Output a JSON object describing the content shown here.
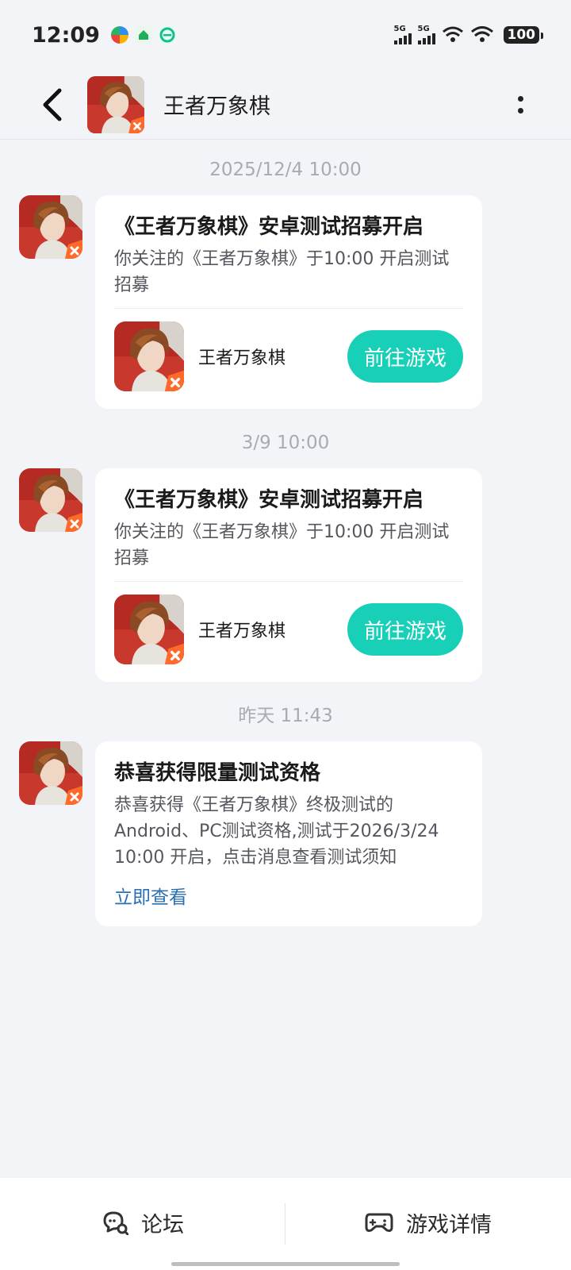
{
  "status_bar": {
    "time": "12:09",
    "signal1": "5G",
    "signal2": "5G",
    "battery": "100"
  },
  "header": {
    "title": "王者万象棋"
  },
  "messages": [
    {
      "time": "2025/12/4  10:00",
      "title": "《王者万象棋》安卓测试招募开启",
      "desc": "你关注的《王者万象棋》于10:00 开启测试招募",
      "game_name": "王者万象棋",
      "button": "前往游戏"
    },
    {
      "time": "3/9  10:00",
      "title": "《王者万象棋》安卓测试招募开启",
      "desc": "你关注的《王者万象棋》于10:00 开启测试招募",
      "game_name": "王者万象棋",
      "button": "前往游戏"
    },
    {
      "time": "昨天  11:43",
      "title": "恭喜获得限量测试资格",
      "desc": "恭喜获得《王者万象棋》终极测试的Android、PC测试资格,测试于2026/3/24 10:00 开启，点击消息查看测试须知",
      "link": "立即查看"
    }
  ],
  "bottom_bar": {
    "forum": "论坛",
    "game_detail": "游戏详情"
  }
}
